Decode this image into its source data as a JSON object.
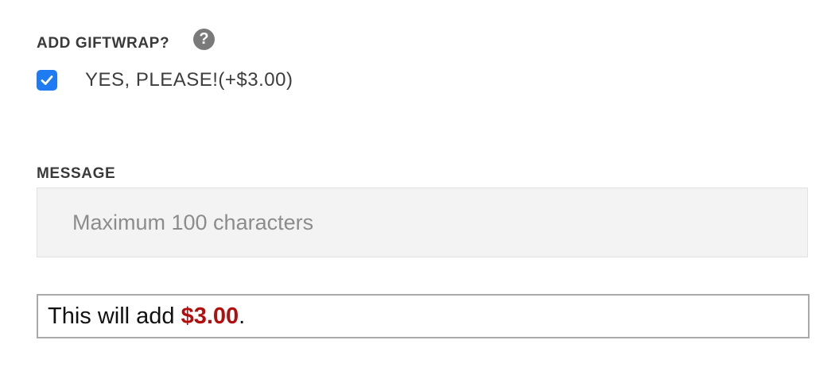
{
  "giftwrap": {
    "label": "ADD GIFTWRAP?",
    "help_icon": "question-mark-circle-icon",
    "option_label": "YES, PLEASE!(+$3.00)",
    "checked": true
  },
  "message": {
    "label": "MESSAGE",
    "placeholder": "Maximum 100 characters",
    "value": ""
  },
  "total": {
    "prefix": "This will add",
    "amount": "$3.00",
    "suffix": "."
  },
  "colors": {
    "checkbox": "#1f7bf2",
    "amount": "#b30d0d",
    "input_bg": "#f3f3f3"
  }
}
